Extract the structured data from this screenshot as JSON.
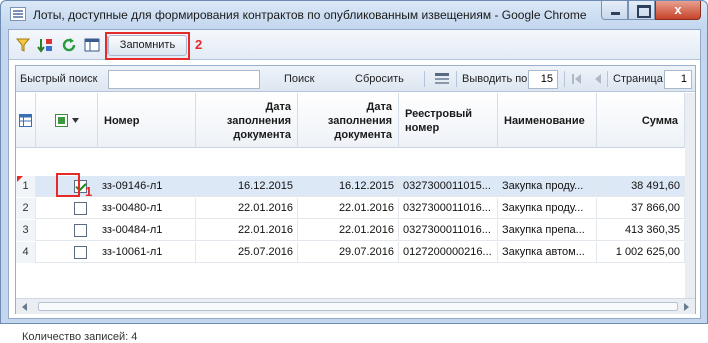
{
  "window": {
    "title": "Лоты, доступные для формирования контрактов по опубликованным извещениям - Google Chrome",
    "close_glyph": "x"
  },
  "toolbar": {
    "icons": [
      "filter-icon",
      "sort-icon",
      "refresh-icon",
      "grid-settings-icon"
    ],
    "remember_label": "Запомнить",
    "highlight_badge": "2"
  },
  "search": {
    "quick_search_label": "Быстрый поиск",
    "quick_search_value": "",
    "search_button": "Поиск",
    "reset_button": "Сбросить",
    "page_size_label": "Выводить по",
    "page_size_value": "15",
    "page_label": "Страница",
    "page_value": "1"
  },
  "grid": {
    "headers": {
      "number": "Номер",
      "date1": "Дата заполнения документа",
      "date2": "Дата заполнения документа",
      "registry": "Реестровый номер",
      "name": "Наименование",
      "sum": "Сумма"
    },
    "rows": [
      {
        "idx": "1",
        "checked": true,
        "number": "зз-09146-л1",
        "date1": "16.12.2015",
        "date2": "16.12.2015",
        "registry": "0327300011015...",
        "name": "Закупка проду...",
        "sum": "38 491,60"
      },
      {
        "idx": "2",
        "checked": false,
        "number": "зз-00480-л1",
        "date1": "22.01.2016",
        "date2": "22.01.2016",
        "registry": "0327300011016...",
        "name": "Закупка проду...",
        "sum": "37 866,00"
      },
      {
        "idx": "3",
        "checked": false,
        "number": "зз-00484-л1",
        "date1": "22.01.2016",
        "date2": "22.01.2016",
        "registry": "0327300011016...",
        "name": "Закупка препа...",
        "sum": "413 360,35"
      },
      {
        "idx": "4",
        "checked": false,
        "number": "зз-10061-л1",
        "date1": "25.07.2016",
        "date2": "29.07.2016",
        "registry": "0127200000216...",
        "name": "Закупка автом...",
        "sum": "1 002 625,00"
      }
    ],
    "highlight_badge": "1"
  },
  "status": {
    "record_count": "Количество записей: 4"
  },
  "colors": {
    "highlight": "#e52a2a",
    "selected_row": "#dde8f6"
  }
}
